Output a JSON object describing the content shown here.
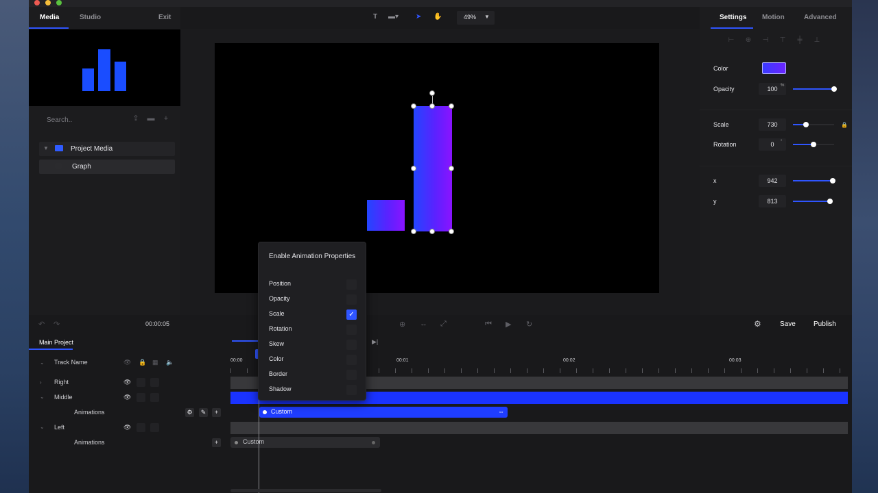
{
  "left_panel": {
    "tabs": [
      {
        "label": "Media"
      },
      {
        "label": "Studio"
      },
      {
        "label": "Exit"
      }
    ],
    "search_placeholder": "Search..",
    "tree": [
      {
        "label": "Project Media",
        "icon": "folder-icon"
      },
      {
        "label": "Graph",
        "icon": "file-icon"
      }
    ]
  },
  "toolbar": {
    "text_tool": "T",
    "zoom": "49%"
  },
  "right_panel": {
    "tabs": [
      {
        "label": "Settings"
      },
      {
        "label": "Motion"
      },
      {
        "label": "Advanced"
      }
    ],
    "color_label": "Color",
    "color_value": "#4b2dff",
    "opacity_label": "Opacity",
    "opacity_value": "100",
    "opacity_unit": "%",
    "scale_label": "Scale",
    "scale_value": "730",
    "rotation_label": "Rotation",
    "rotation_value": "0",
    "rotation_unit": "°",
    "x_label": "x",
    "x_value": "942",
    "y_label": "y",
    "y_value": "813"
  },
  "playbar": {
    "timecode": "00:00:05",
    "save_label": "Save",
    "publish_label": "Publish"
  },
  "timeline": {
    "project_tab": "Main Project",
    "header_label": "Track Name",
    "ruler": [
      "00:00",
      "00:01",
      "00:02",
      "00:03"
    ],
    "tracks": [
      {
        "label": "Right"
      },
      {
        "label": "Middle"
      },
      {
        "label": "Animations"
      },
      {
        "label": "Left"
      },
      {
        "label": "Animations"
      }
    ],
    "clip_middle": "Custom",
    "clip_left": "Custom"
  },
  "popup": {
    "title": "Enable Animation Properties",
    "items": [
      {
        "label": "Position",
        "checked": false
      },
      {
        "label": "Opacity",
        "checked": false
      },
      {
        "label": "Scale",
        "checked": true
      },
      {
        "label": "Rotation",
        "checked": false
      },
      {
        "label": "Skew",
        "checked": false
      },
      {
        "label": "Color",
        "checked": false
      },
      {
        "label": "Border",
        "checked": false
      },
      {
        "label": "Shadow",
        "checked": false
      }
    ]
  },
  "colors": {
    "accent": "#2f55ff",
    "shape_gradient_start": "#2346ff",
    "shape_gradient_end": "#8a13ff"
  }
}
